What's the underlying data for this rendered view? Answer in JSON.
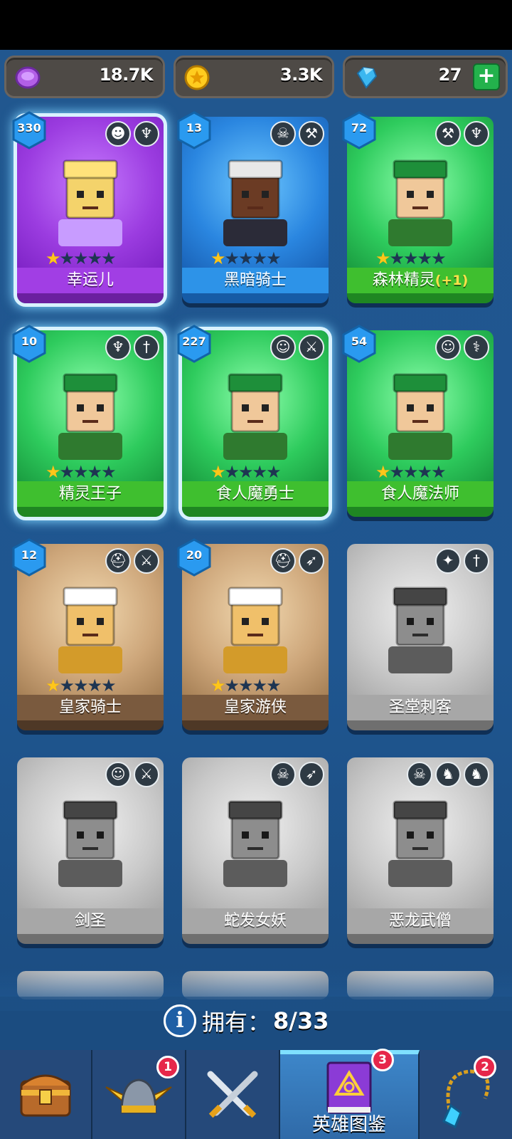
{
  "currency": {
    "gems_purple": "18.7K",
    "coins": "3.3K",
    "diamonds": "27",
    "add_label": "+"
  },
  "heroes": [
    {
      "name": "幸运儿",
      "level": "330",
      "rarity": "purple",
      "stars": 1,
      "max_stars": 5,
      "owned": true,
      "selected": true,
      "class_icons": [
        "jester-face-icon",
        "elf-face-icon"
      ]
    },
    {
      "name": "黑暗骑士",
      "level": "13",
      "rarity": "blue",
      "stars": 1,
      "max_stars": 5,
      "owned": true,
      "selected": false,
      "class_icons": [
        "skull-icon",
        "hammer-icon"
      ]
    },
    {
      "name": "森林精灵",
      "bonus": "(+1)",
      "level": "72",
      "rarity": "green",
      "stars": 1,
      "max_stars": 5,
      "owned": true,
      "selected": false,
      "class_icons": [
        "hammer-icon",
        "elf-face-icon"
      ]
    },
    {
      "name": "精灵王子",
      "level": "10",
      "rarity": "green",
      "stars": 1,
      "max_stars": 5,
      "owned": true,
      "selected": true,
      "class_icons": [
        "elf-face-icon",
        "dagger-icon"
      ]
    },
    {
      "name": "食人魔勇士",
      "level": "227",
      "rarity": "green",
      "stars": 1,
      "max_stars": 5,
      "owned": true,
      "selected": true,
      "class_icons": [
        "orc-face-icon",
        "sword-icon"
      ]
    },
    {
      "name": "食人魔法师",
      "level": "54",
      "rarity": "green",
      "stars": 1,
      "max_stars": 5,
      "owned": true,
      "selected": false,
      "class_icons": [
        "orc-face-icon",
        "staff-icon"
      ]
    },
    {
      "name": "皇家骑士",
      "level": "12",
      "rarity": "brown",
      "stars": 1,
      "max_stars": 5,
      "owned": true,
      "selected": false,
      "class_icons": [
        "helmet-icon",
        "sword-icon"
      ]
    },
    {
      "name": "皇家游侠",
      "level": "20",
      "rarity": "brown",
      "stars": 1,
      "max_stars": 5,
      "owned": true,
      "selected": false,
      "class_icons": [
        "helmet-icon",
        "bow-icon"
      ]
    },
    {
      "name": "圣堂刺客",
      "level": "",
      "rarity": "gray",
      "stars": 0,
      "max_stars": 0,
      "owned": false,
      "selected": false,
      "class_icons": [
        "winged-emblem-icon",
        "dagger-icon"
      ]
    },
    {
      "name": "剑圣",
      "level": "",
      "rarity": "gray",
      "stars": 0,
      "max_stars": 0,
      "owned": false,
      "selected": false,
      "class_icons": [
        "orc-face-icon",
        "sword-icon"
      ]
    },
    {
      "name": "蛇发女妖",
      "level": "",
      "rarity": "gray",
      "stars": 0,
      "max_stars": 0,
      "owned": false,
      "selected": false,
      "class_icons": [
        "skull-icon",
        "bow-icon"
      ]
    },
    {
      "name": "恶龙武僧",
      "level": "",
      "rarity": "gray",
      "stars": 0,
      "max_stars": 0,
      "owned": false,
      "selected": false,
      "class_icons": [
        "skull-icon",
        "dragon-icon",
        "dragon-icon"
      ]
    }
  ],
  "owned_summary": {
    "label": "拥有：",
    "count": "8/33"
  },
  "nav": {
    "tabs": [
      {
        "id": "chest",
        "label": "",
        "icon": "treasure-chest-icon",
        "badge": ""
      },
      {
        "id": "heroes",
        "label": "",
        "icon": "winged-helmet-icon",
        "badge": "1"
      },
      {
        "id": "battle",
        "label": "",
        "icon": "crossed-swords-icon",
        "badge": ""
      },
      {
        "id": "codex",
        "label": "英雄图鉴",
        "icon": "spellbook-icon",
        "badge": "3",
        "active": true
      },
      {
        "id": "items",
        "label": "",
        "icon": "amulet-icon",
        "badge": "2"
      }
    ]
  },
  "colors": {
    "background": "#1f5690",
    "star_on": "#ffc61a",
    "badge_red": "#e6274a",
    "plus_green": "#23b24c"
  }
}
